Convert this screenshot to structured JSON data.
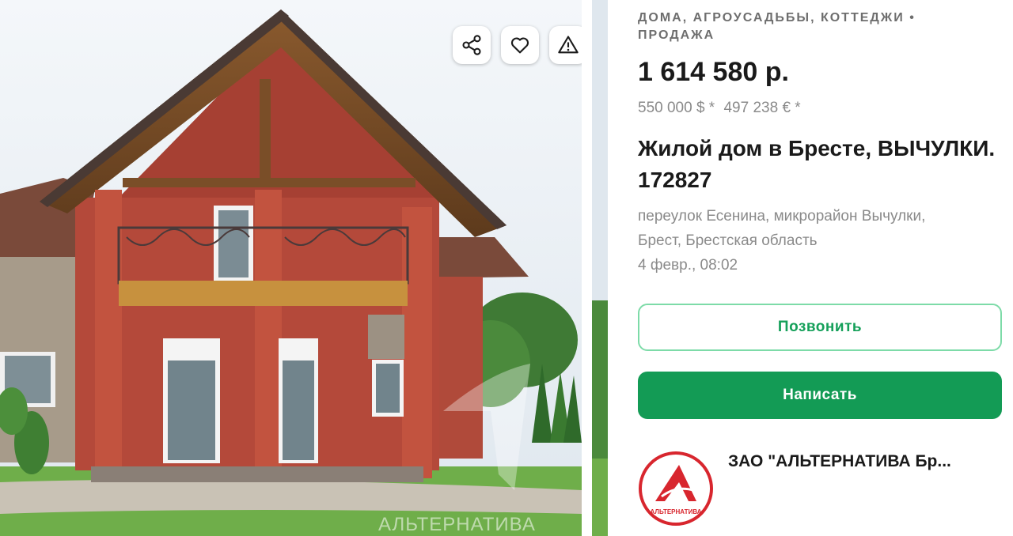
{
  "photo": {
    "actions": [
      {
        "name": "share",
        "icon": "share-icon"
      },
      {
        "name": "favorite",
        "icon": "heart-icon"
      },
      {
        "name": "report",
        "icon": "warning-icon"
      }
    ],
    "watermark": "АЛЬТЕРНАТИВА"
  },
  "listing": {
    "category": "ДОМА, АГРОУСАДЬБЫ, КОТТЕДЖИ • ПРОДАЖА",
    "price": "1 614 580 р.",
    "price_usd": "550 000 $ *",
    "price_eur": "497 238 € *",
    "title": "Жилой дом в Бресте, ВЫЧУЛКИ. 172827",
    "address_line1": "переулок Есенина, микрорайон Вычулки,",
    "address_line2": "Брест, Брестская область",
    "date": "4 февр., 08:02"
  },
  "actions": {
    "call_label": "Позвонить",
    "write_label": "Написать"
  },
  "seller": {
    "name": "ЗАО \"АЛЬТЕРНАТИВА Бр...",
    "logo_text": "АЛЬТЕРНАТИВА"
  },
  "colors": {
    "accent": "#139b55",
    "accent_light": "#7ddba8",
    "text_primary": "#1a1a1a",
    "text_secondary": "#8a8a8a"
  }
}
